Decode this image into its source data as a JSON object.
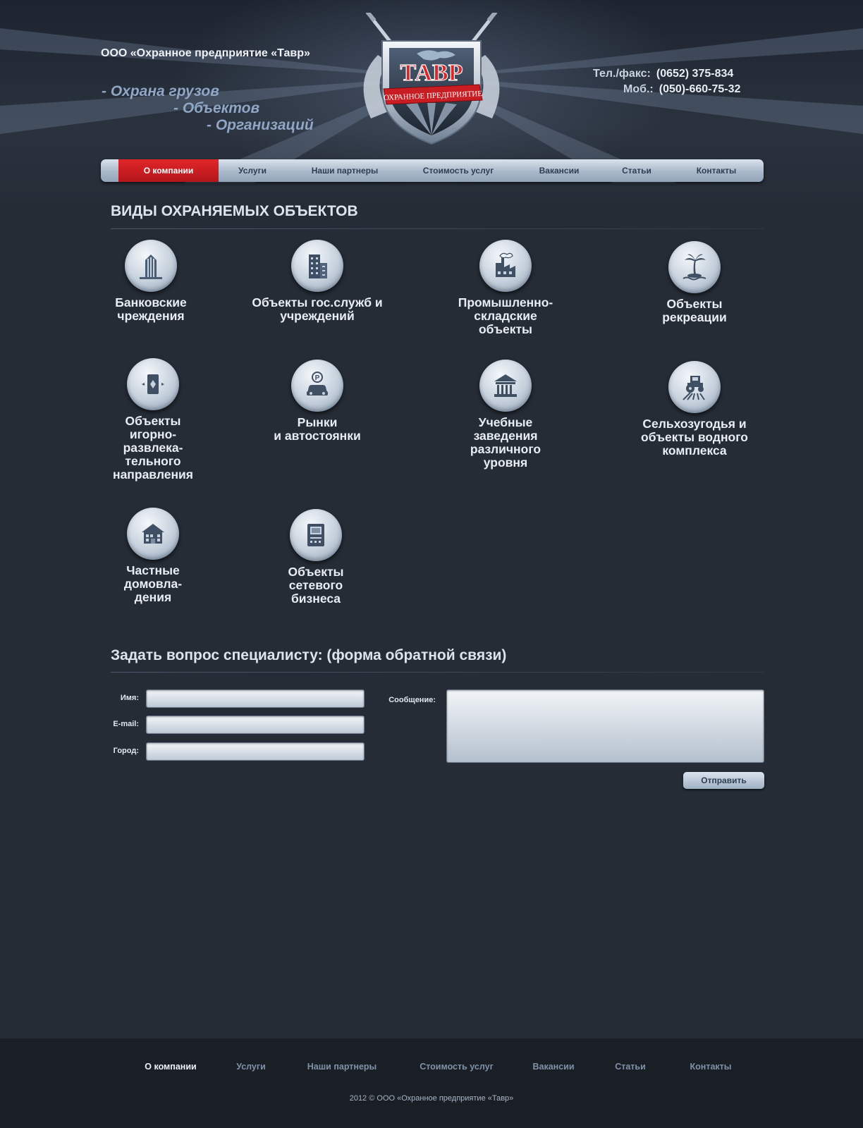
{
  "header": {
    "company_name": "ООО «Охранное предприятие «Тавр»",
    "slogans": [
      "- Охрана грузов",
      "- Объектов",
      "- Организаций"
    ],
    "logo_text": "ТАВР",
    "logo_ribbon": "ОХРАННОЕ ПРЕДПРИЯТИЕ",
    "phone_label": "Тел./факс:",
    "phone_value": "(0652) 375-834",
    "mobile_label": "Моб.:",
    "mobile_value": "(050)-660-75-32"
  },
  "nav": {
    "items": [
      {
        "label": "О компании",
        "active": true
      },
      {
        "label": "Услуги",
        "active": false
      },
      {
        "label": "Наши партнеры",
        "active": false
      },
      {
        "label": "Стоимость услуг",
        "active": false
      },
      {
        "label": "Вакансии",
        "active": false
      },
      {
        "label": "Статьи",
        "active": false
      },
      {
        "label": "Контакты",
        "active": false
      }
    ]
  },
  "objects": {
    "title": "ВИДЫ ОХРАНЯЕМЫХ ОБЪЕКТОВ",
    "items": [
      {
        "label": "Банковские\nчреждения",
        "icon": "bank-building-icon"
      },
      {
        "label": "Объекты гос.служб и\nучреждений",
        "icon": "office-building-icon"
      },
      {
        "label": "Промышленно-\nскладские\nобъекты",
        "icon": "factory-icon"
      },
      {
        "label": "Объекты\nрекреации",
        "icon": "palm-island-icon"
      },
      {
        "label": "Объекты\nигорно-\nразвлека-\nтельного\nнаправления",
        "icon": "playing-card-icon"
      },
      {
        "label": "Рынки\nи автостоянки",
        "icon": "parking-car-icon"
      },
      {
        "label": "Учебные\nзаведения\nразличного\nуровня",
        "icon": "school-building-icon"
      },
      {
        "label": "Сельхозугодья и\nобъекты водного\nкомплекса",
        "icon": "tractor-icon"
      },
      {
        "label": "Частные\nдомовла-\nдения",
        "icon": "house-icon"
      },
      {
        "label": "Объекты\nсетевого\nбизнеса",
        "icon": "atm-terminal-icon"
      }
    ]
  },
  "feedback": {
    "title": "Задать вопрос специалисту: (форма обратной связи)",
    "name_label": "Имя:",
    "email_label": "E-mail:",
    "city_label": "Город:",
    "message_label": "Сообщение:",
    "submit_label": "Отправить"
  },
  "footer": {
    "links": [
      {
        "label": "О компании",
        "active": true
      },
      {
        "label": "Услуги",
        "active": false
      },
      {
        "label": "Наши партнеры",
        "active": false
      },
      {
        "label": "Стоимость услуг",
        "active": false
      },
      {
        "label": "Вакансии",
        "active": false
      },
      {
        "label": "Статьи",
        "active": false
      },
      {
        "label": "Контакты",
        "active": false
      }
    ],
    "copyright": "2012 © ООО «Охранное предприятие «Тавр»"
  },
  "colors": {
    "background": "#252c36",
    "accent_red": "#d21e23",
    "slogan_blue": "#8fa6c4",
    "nav_text": "#2f3e52"
  }
}
